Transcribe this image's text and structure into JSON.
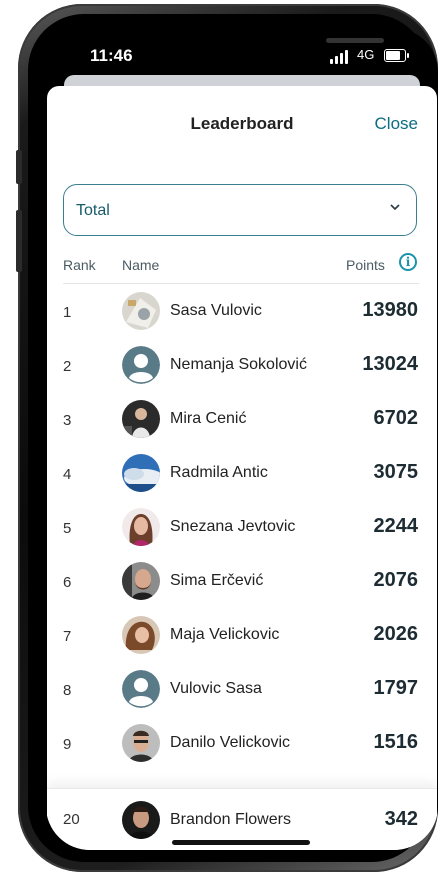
{
  "status_bar": {
    "time": "11:46",
    "network": "4G"
  },
  "header": {
    "title": "Leaderboard",
    "close_label": "Close"
  },
  "filter": {
    "selected": "Total"
  },
  "columns": {
    "rank": "Rank",
    "name": "Name",
    "points": "Points"
  },
  "rows": [
    {
      "rank": "1",
      "name": "Sasa Vulovic",
      "points": "13980",
      "avatar": "photo"
    },
    {
      "rank": "2",
      "name": "Nemanja Sokolović",
      "points": "13024",
      "avatar": "placeholder"
    },
    {
      "rank": "3",
      "name": "Mira Cenić",
      "points": "6702",
      "avatar": "photo"
    },
    {
      "rank": "4",
      "name": "Radmila Antic",
      "points": "3075",
      "avatar": "photo"
    },
    {
      "rank": "5",
      "name": "Snezana Jevtovic",
      "points": "2244",
      "avatar": "photo"
    },
    {
      "rank": "6",
      "name": "Sima Erčević",
      "points": "2076",
      "avatar": "photo"
    },
    {
      "rank": "7",
      "name": "Maja Velickovic",
      "points": "2026",
      "avatar": "photo"
    },
    {
      "rank": "8",
      "name": "Vulovic Sasa",
      "points": "1797",
      "avatar": "placeholder"
    },
    {
      "rank": "9",
      "name": "Danilo Velickovic",
      "points": "1516",
      "avatar": "photo"
    }
  ],
  "current_user": {
    "rank": "20",
    "name": "Brandon Flowers",
    "points": "342",
    "avatar": "photo"
  },
  "colors": {
    "accent": "#0b6d82",
    "info": "#1b93ab",
    "placeholder_avatar": "#587b87"
  }
}
